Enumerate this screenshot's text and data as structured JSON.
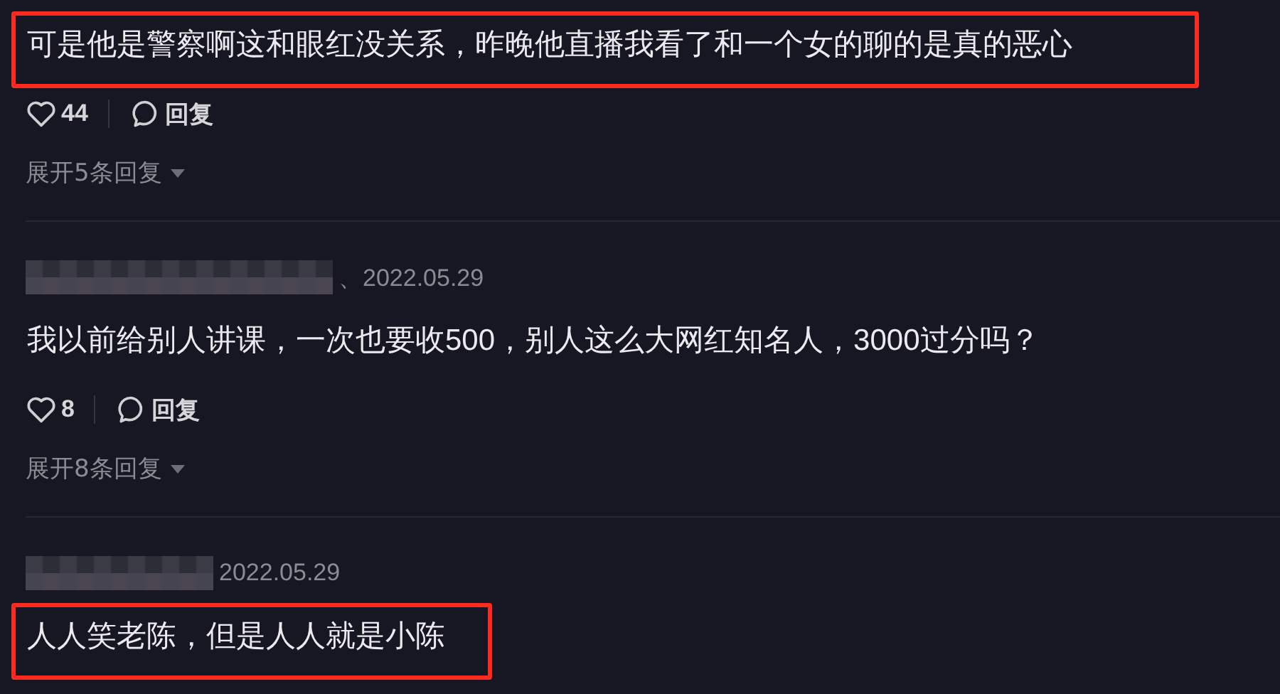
{
  "comments": [
    {
      "author_hidden": false,
      "text": "可是他是警察啊这和眼红没关系，昨晚他直播我看了和一个女的聊的是真的恶心",
      "highlighted": true,
      "likes": "44",
      "reply": "回复",
      "expand": "展开5条回复"
    },
    {
      "author_hidden": true,
      "date": "、2022.05.29",
      "text": "我以前给别人讲课，一次也要收500，别人这么大网红知名人，3000过分吗？",
      "highlighted": false,
      "likes": "8",
      "reply": "回复",
      "expand": "展开8条回复"
    },
    {
      "author_hidden": true,
      "date": "2022.05.29",
      "text": "人人笑老陈，但是人人就是小陈",
      "highlighted": true
    }
  ]
}
